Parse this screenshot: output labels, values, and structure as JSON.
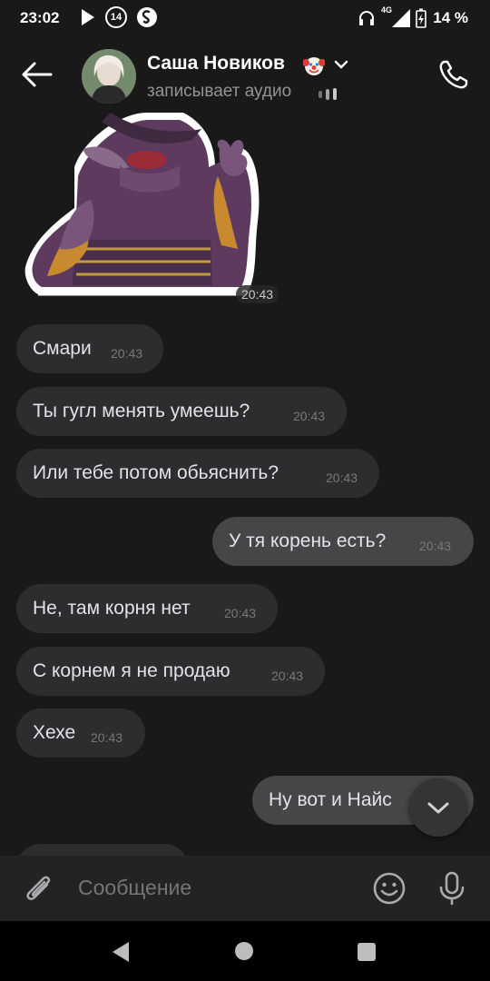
{
  "status_bar": {
    "time": "23:02",
    "notification_count": "14",
    "network": "4G",
    "battery": "14 %"
  },
  "header": {
    "contact_name": "Саша Новиков",
    "status": "записывает аудио"
  },
  "messages": [
    {
      "direction": "in",
      "kind": "sticker",
      "time": "20:43"
    },
    {
      "direction": "in",
      "text": "Смари",
      "time": "20:43"
    },
    {
      "direction": "in",
      "text": "Ты гугл менять умеешь?",
      "time": "20:43"
    },
    {
      "direction": "in",
      "text": "Или тебе потом обьяснить?",
      "time": "20:43"
    },
    {
      "direction": "out",
      "text": "У тя корень есть?",
      "time": "20:43"
    },
    {
      "direction": "in",
      "text": "Не, там корня нет",
      "time": "20:43"
    },
    {
      "direction": "in",
      "text": "С корнем я не продаю",
      "time": "20:43"
    },
    {
      "direction": "in",
      "text": "Хехе",
      "time": "20:43"
    },
    {
      "direction": "out",
      "text": "Ну вот и Найс",
      "time": ""
    }
  ],
  "composer": {
    "placeholder": "Сообщение"
  },
  "icons": {
    "back": "arrow-left-icon",
    "call": "phone-icon",
    "attach": "paperclip-icon",
    "emoji": "smile-icon",
    "mic": "microphone-icon",
    "scroll_down": "chevron-down-icon"
  },
  "colors": {
    "background": "#19191a",
    "bubble_in": "#2c2d2e",
    "bubble_out": "#454647",
    "text": "#e1e3e6",
    "time": "#76787a"
  }
}
